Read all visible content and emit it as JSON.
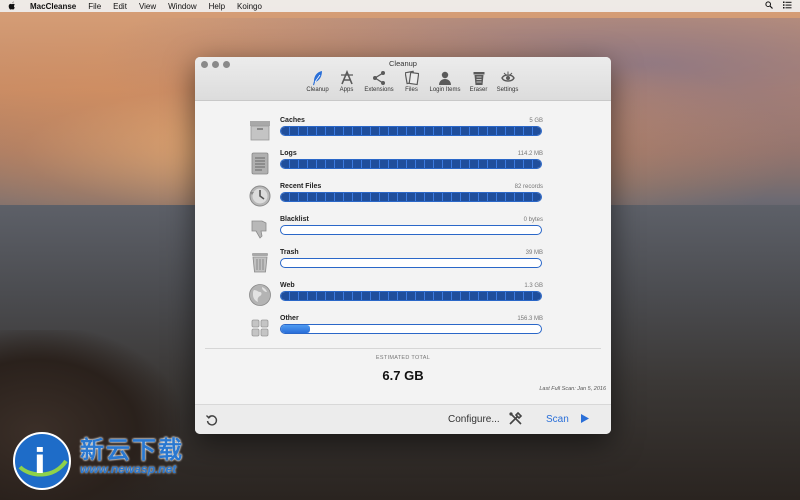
{
  "menubar": {
    "apple": "",
    "app_name": "MacCleanse",
    "items": [
      "File",
      "Edit",
      "View",
      "Window",
      "Help",
      "Koingo"
    ]
  },
  "window": {
    "title": "Cleanup",
    "toolbar": [
      {
        "label": "Cleanup",
        "icon": "feather-icon",
        "active": true
      },
      {
        "label": "Apps",
        "icon": "apps-icon",
        "active": false
      },
      {
        "label": "Extensions",
        "icon": "share-icon",
        "active": false
      },
      {
        "label": "Files",
        "icon": "files-icon",
        "active": false
      },
      {
        "label": "Login Items",
        "icon": "user-icon",
        "active": false
      },
      {
        "label": "Eraser",
        "icon": "trash-icon",
        "active": false
      },
      {
        "label": "Settings",
        "icon": "eye-icon",
        "active": false
      }
    ],
    "categories": [
      {
        "name": "Caches",
        "size": "5 GB",
        "icon": "box-icon",
        "fill": 1.0
      },
      {
        "name": "Logs",
        "size": "114.2 MB",
        "icon": "document-icon",
        "fill": 1.0
      },
      {
        "name": "Recent Files",
        "size": "82 records",
        "icon": "clock-icon",
        "fill": 1.0
      },
      {
        "name": "Blacklist",
        "size": "0 bytes",
        "icon": "thumbs-down-icon",
        "fill": 0.0
      },
      {
        "name": "Trash",
        "size": "39 MB",
        "icon": "trash-can-icon",
        "fill": 0.0
      },
      {
        "name": "Web",
        "size": "1.3 GB",
        "icon": "globe-icon",
        "fill": 1.0
      },
      {
        "name": "Other",
        "size": "156.3 MB",
        "icon": "grid-icon",
        "fill": 0.11
      }
    ],
    "estimated_label": "ESTIMATED TOTAL",
    "estimated_value": "6.7 GB",
    "last_scan": "Last Full Scan: Jan 5, 2016",
    "footer": {
      "configure_label": "Configure...",
      "scan_label": "Scan"
    }
  },
  "watermark": {
    "name": "新云下载",
    "url": "www.newasp.net"
  },
  "colors": {
    "accent": "#2a6fd8",
    "bar_border": "#2a67c8",
    "bar_fill": "#1f4e9c"
  }
}
